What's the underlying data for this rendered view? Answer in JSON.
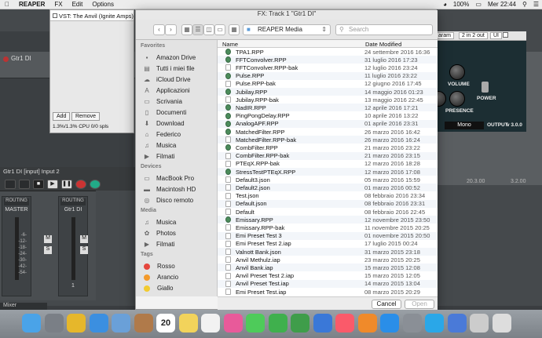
{
  "menubar": {
    "app": "REAPER",
    "items": [
      "FX",
      "Edit",
      "Options"
    ],
    "battery": "100%",
    "clock": "Mer 22:44"
  },
  "reaper": {
    "track_name": "Gtr1 DI",
    "input_label": "Gtr1 DI [input] Input 2",
    "ruler": [
      "20.3.00",
      "3.2.00"
    ],
    "mixer": {
      "master": "MASTER",
      "track": "Gtr1 DI",
      "tab": "Mixer",
      "routing": "ROUTING",
      "fx": "FX",
      "track_num": "1"
    },
    "fader_scale": [
      "-inf",
      "-inf",
      "-6-",
      "-12-",
      "-18-",
      "-24-",
      "-30-",
      "-42-",
      "-54-"
    ]
  },
  "fx_window": {
    "plugin": "VST: The Anvil (Ignite Amps)",
    "add": "Add",
    "remove": "Remove",
    "cpu": "1.3%/1.3% CPU 0/0 spls"
  },
  "plugin": {
    "param_btn": "aram",
    "preset": "2 in 2 out",
    "ui": "UI",
    "volume": "VOLUME",
    "presence": "PRESENCE",
    "power": "POWER",
    "channel": "Mono",
    "output": "OUTPUT",
    "version": "v 3.0.0"
  },
  "dialog": {
    "title": "FX: Track 1 \"Gtr1 DI\"",
    "folder": "REAPER Media",
    "search_placeholder": "Search",
    "col_name": "Name",
    "col_date": "Date Modified",
    "cancel": "Cancel",
    "open": "Open",
    "favorites_header": "Favorites",
    "devices_header": "Devices",
    "media_header": "Media",
    "tags_header": "Tags",
    "favorites": [
      {
        "label": "Amazon Drive",
        "icon": "folder-icon"
      },
      {
        "label": "Tutti i miei file",
        "icon": "files-icon"
      },
      {
        "label": "iCloud Drive",
        "icon": "cloud-icon"
      },
      {
        "label": "Applicazioni",
        "icon": "apps-icon"
      },
      {
        "label": "Scrivania",
        "icon": "desktop-icon"
      },
      {
        "label": "Documenti",
        "icon": "documents-icon"
      },
      {
        "label": "Download",
        "icon": "download-icon"
      },
      {
        "label": "Federico",
        "icon": "home-icon"
      },
      {
        "label": "Musica",
        "icon": "music-icon"
      },
      {
        "label": "Filmati",
        "icon": "movies-icon"
      }
    ],
    "devices": [
      {
        "label": "MacBook Pro",
        "icon": "laptop-icon"
      },
      {
        "label": "Macintosh HD",
        "icon": "disk-icon"
      },
      {
        "label": "Disco remoto",
        "icon": "remote-disk-icon"
      }
    ],
    "media": [
      {
        "label": "Musica",
        "icon": "music-icon"
      },
      {
        "label": "Photos",
        "icon": "photos-icon"
      },
      {
        "label": "Filmati",
        "icon": "movies-icon"
      }
    ],
    "tags": [
      {
        "label": "Rosso",
        "color": "#e5463d"
      },
      {
        "label": "Arancio",
        "color": "#f39a2b"
      },
      {
        "label": "Giallo",
        "color": "#f2cb30"
      }
    ],
    "files": [
      {
        "name": "TPA1.RPP",
        "date": "24 settembre 2016 16:36",
        "type": "rpp"
      },
      {
        "name": "FFTConvolver.RPP",
        "date": "31 luglio 2016 17:23",
        "type": "rpp"
      },
      {
        "name": "FFTConvolver.RPP-bak",
        "date": "12 luglio 2016 23:24",
        "type": "doc"
      },
      {
        "name": "Pulse.RPP",
        "date": "11 luglio 2016 23:22",
        "type": "rpp"
      },
      {
        "name": "Pulse.RPP-bak",
        "date": "12 giugno 2016 17:45",
        "type": "doc"
      },
      {
        "name": "Jubilay.RPP",
        "date": "14 maggio 2016 01:23",
        "type": "rpp"
      },
      {
        "name": "Jubilay.RPP-bak",
        "date": "13 maggio 2016 22:45",
        "type": "doc"
      },
      {
        "name": "NadIR.RPP",
        "date": "12 aprile 2016 17:21",
        "type": "rpp"
      },
      {
        "name": "PingPongDelay.RPP",
        "date": "10 aprile 2016 13:22",
        "type": "rpp"
      },
      {
        "name": "AnalogAPF.RPP",
        "date": "01 aprile 2016 23:31",
        "type": "rpp"
      },
      {
        "name": "MatchedFilter.RPP",
        "date": "26 marzo 2016 16:42",
        "type": "rpp"
      },
      {
        "name": "MatchedFilter.RPP-bak",
        "date": "26 marzo 2016 16:24",
        "type": "doc"
      },
      {
        "name": "CombFilter.RPP",
        "date": "21 marzo 2016 23:22",
        "type": "rpp"
      },
      {
        "name": "CombFilter.RPP-bak",
        "date": "21 marzo 2016 23:15",
        "type": "doc"
      },
      {
        "name": "PTEqX.RPP-bak",
        "date": "12 marzo 2016 18:28",
        "type": "doc"
      },
      {
        "name": "StressTestPTEqX.RPP",
        "date": "12 marzo 2016 17:08",
        "type": "rpp"
      },
      {
        "name": "Default3.json",
        "date": "05 marzo 2016 15:59",
        "type": "doc"
      },
      {
        "name": "Default2.json",
        "date": "01 marzo 2016 00:52",
        "type": "doc"
      },
      {
        "name": "Test.json",
        "date": "08 febbraio 2016 23:34",
        "type": "doc"
      },
      {
        "name": "Default.json",
        "date": "08 febbraio 2016 23:31",
        "type": "doc"
      },
      {
        "name": "Default",
        "date": "08 febbraio 2016 22:45",
        "type": "doc"
      },
      {
        "name": "Emissary.RPP",
        "date": "12 novembre 2015 23:50",
        "type": "rpp"
      },
      {
        "name": "Emissary.RPP-bak",
        "date": "11 novembre 2015 20:25",
        "type": "doc"
      },
      {
        "name": "Emi Preset Test 3",
        "date": "01 novembre 2015 20:50",
        "type": "doc"
      },
      {
        "name": "Emi Preset Test 2.iap",
        "date": "17 luglio 2015 00:24",
        "type": "doc"
      },
      {
        "name": "Valnott Bank.json",
        "date": "31 marzo 2015 23:18",
        "type": "doc"
      },
      {
        "name": "Anvil Methulz.iap",
        "date": "23 marzo 2015 20:25",
        "type": "doc"
      },
      {
        "name": "Anvil Bank.iap",
        "date": "15 marzo 2015 12:08",
        "type": "doc"
      },
      {
        "name": "Anvil Preset Test 2.iap",
        "date": "15 marzo 2015 12:05",
        "type": "doc"
      },
      {
        "name": "Anvil Preset Test.iap",
        "date": "14 marzo 2015 13:04",
        "type": "doc"
      },
      {
        "name": "Emi Preset Test.iap",
        "date": "08 marzo 2015 20:29",
        "type": "doc"
      }
    ]
  },
  "dock": {
    "calendar_day": "20",
    "apps": [
      "Finder",
      "Launchpad",
      "Chrome",
      "Safari",
      "Mail",
      "Contacts",
      "Calendar",
      "Notes",
      "Reminders",
      "Photos",
      "Messages",
      "FaceTime",
      "Numbers",
      "Keynote",
      "Music",
      "Books",
      "App Store",
      "Settings",
      "Skype",
      "Xcode",
      "Ableton",
      "Trash"
    ]
  }
}
